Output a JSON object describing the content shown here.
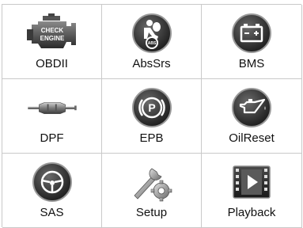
{
  "menu": {
    "items": [
      {
        "label": "OBDII",
        "icon": "check-engine-icon"
      },
      {
        "label": "AbsSrs",
        "icon": "airbag-abs-icon"
      },
      {
        "label": "BMS",
        "icon": "battery-icon"
      },
      {
        "label": "DPF",
        "icon": "particulate-filter-icon"
      },
      {
        "label": "EPB",
        "icon": "parking-brake-icon"
      },
      {
        "label": "OilReset",
        "icon": "oil-can-icon"
      },
      {
        "label": "SAS",
        "icon": "steering-wheel-icon"
      },
      {
        "label": "Setup",
        "icon": "wrench-gear-icon"
      },
      {
        "label": "Playback",
        "icon": "video-play-icon"
      }
    ],
    "check_engine_text": [
      "CHECK",
      "ENGINE"
    ],
    "abs_text": "ABS"
  }
}
